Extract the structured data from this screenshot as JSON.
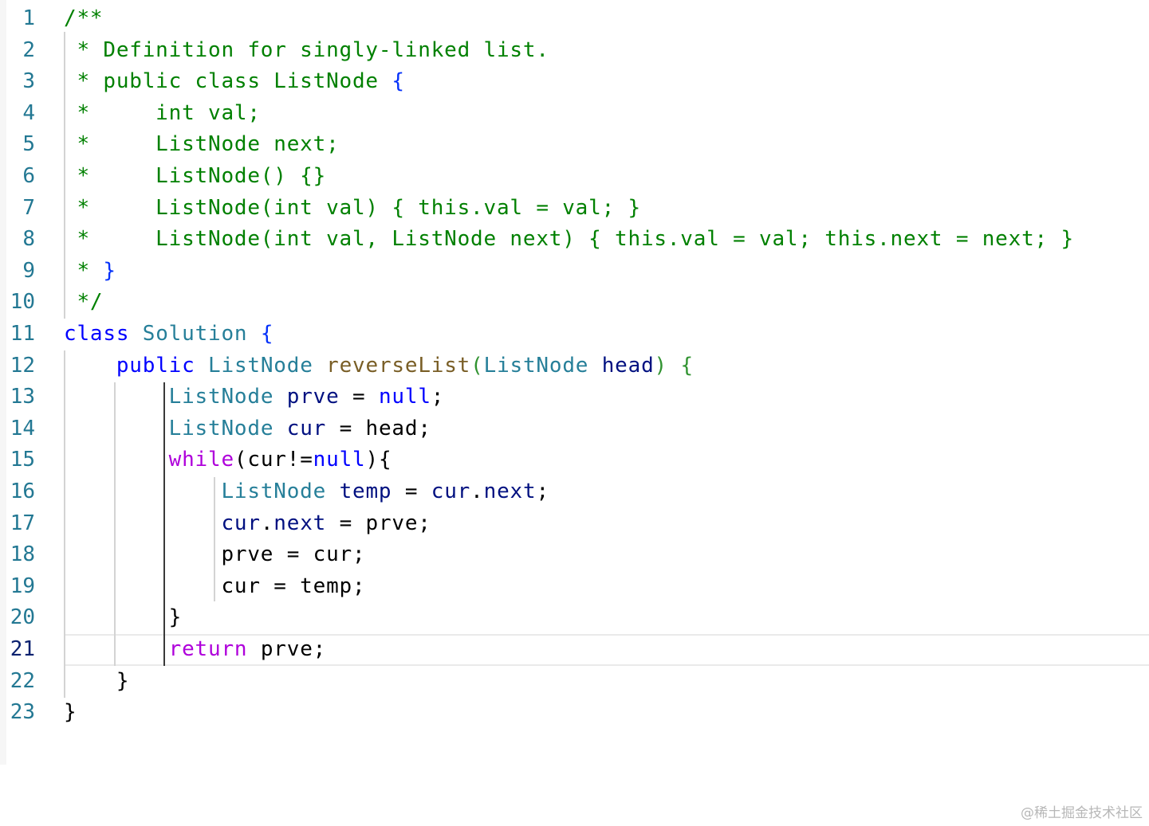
{
  "editor": {
    "lines": [
      {
        "n": "1",
        "tokens": [
          [
            "/**",
            "comment"
          ]
        ]
      },
      {
        "n": "2",
        "tokens": [
          [
            " * Definition for singly-linked list.",
            "comment"
          ]
        ]
      },
      {
        "n": "3",
        "tokens": [
          [
            " * public class ListNode ",
            "comment"
          ],
          [
            "{",
            "brace1"
          ]
        ]
      },
      {
        "n": "4",
        "tokens": [
          [
            " *     int val;",
            "comment"
          ]
        ]
      },
      {
        "n": "5",
        "tokens": [
          [
            " *     ListNode next;",
            "comment"
          ]
        ]
      },
      {
        "n": "6",
        "tokens": [
          [
            " *     ListNode() {}",
            "comment"
          ]
        ]
      },
      {
        "n": "7",
        "tokens": [
          [
            " *     ListNode(int val) { this.val = val; }",
            "comment"
          ]
        ]
      },
      {
        "n": "8",
        "tokens": [
          [
            " *     ListNode(int val, ListNode next) { this.val = val; this.next = next; }",
            "comment"
          ]
        ]
      },
      {
        "n": "9",
        "tokens": [
          [
            " * ",
            "comment"
          ],
          [
            "}",
            "brace1"
          ]
        ]
      },
      {
        "n": "10",
        "tokens": [
          [
            " */",
            "comment"
          ]
        ]
      },
      {
        "n": "11",
        "tokens": [
          [
            "class",
            "keyword"
          ],
          [
            " ",
            "plain"
          ],
          [
            "Solution",
            "type"
          ],
          [
            " ",
            "plain"
          ],
          [
            "{",
            "brace1"
          ]
        ]
      },
      {
        "n": "12",
        "tokens": [
          [
            "    ",
            "plain"
          ],
          [
            "public",
            "keyword"
          ],
          [
            " ",
            "plain"
          ],
          [
            "ListNode",
            "type"
          ],
          [
            " ",
            "plain"
          ],
          [
            "reverseList",
            "func"
          ],
          [
            "(",
            "brace2"
          ],
          [
            "ListNode",
            "type"
          ],
          [
            " ",
            "plain"
          ],
          [
            "head",
            "var"
          ],
          [
            ")",
            "brace2"
          ],
          [
            " ",
            "plain"
          ],
          [
            "{",
            "brace2"
          ]
        ]
      },
      {
        "n": "13",
        "tokens": [
          [
            "        ",
            "plain"
          ],
          [
            "ListNode",
            "type"
          ],
          [
            " ",
            "plain"
          ],
          [
            "prve",
            "var"
          ],
          [
            " = ",
            "plain"
          ],
          [
            "null",
            "keyword"
          ],
          [
            ";",
            "plain"
          ]
        ]
      },
      {
        "n": "14",
        "tokens": [
          [
            "        ",
            "plain"
          ],
          [
            "ListNode",
            "type"
          ],
          [
            " ",
            "plain"
          ],
          [
            "cur",
            "var"
          ],
          [
            " = ",
            "plain"
          ],
          [
            "head;",
            "plain"
          ]
        ]
      },
      {
        "n": "15",
        "tokens": [
          [
            "        ",
            "plain"
          ],
          [
            "while",
            "control"
          ],
          [
            "(cur!=",
            "plain"
          ],
          [
            "null",
            "keyword"
          ],
          [
            "){",
            "plain"
          ]
        ]
      },
      {
        "n": "16",
        "tokens": [
          [
            "            ",
            "plain"
          ],
          [
            "ListNode",
            "type"
          ],
          [
            " ",
            "plain"
          ],
          [
            "temp",
            "var"
          ],
          [
            " = ",
            "plain"
          ],
          [
            "cur",
            "var"
          ],
          [
            ".",
            "plain"
          ],
          [
            "next",
            "var"
          ],
          [
            ";",
            "plain"
          ]
        ]
      },
      {
        "n": "17",
        "tokens": [
          [
            "            ",
            "plain"
          ],
          [
            "cur",
            "var"
          ],
          [
            ".",
            "plain"
          ],
          [
            "next",
            "var"
          ],
          [
            " = prve;",
            "plain"
          ]
        ]
      },
      {
        "n": "18",
        "tokens": [
          [
            "            prve = cur;",
            "plain"
          ]
        ]
      },
      {
        "n": "19",
        "tokens": [
          [
            "            cur = temp;",
            "plain"
          ]
        ]
      },
      {
        "n": "20",
        "tokens": [
          [
            "        }",
            "plain"
          ]
        ]
      },
      {
        "n": "21",
        "tokens": [
          [
            "        ",
            "plain"
          ],
          [
            "return",
            "control"
          ],
          [
            " prve;",
            "plain"
          ]
        ]
      },
      {
        "n": "22",
        "tokens": [
          [
            "    }",
            "plain"
          ]
        ]
      },
      {
        "n": "23",
        "tokens": [
          [
            "}",
            "plain"
          ]
        ]
      }
    ],
    "current_line": "21"
  },
  "watermark": "@稀土掘金技术社区",
  "colors": {
    "comment": "#008000",
    "keyword": "#0000ff",
    "type": "#267f99",
    "function": "#795e26",
    "variable": "#001080",
    "control": "#af00db",
    "line_number": "#237893"
  }
}
